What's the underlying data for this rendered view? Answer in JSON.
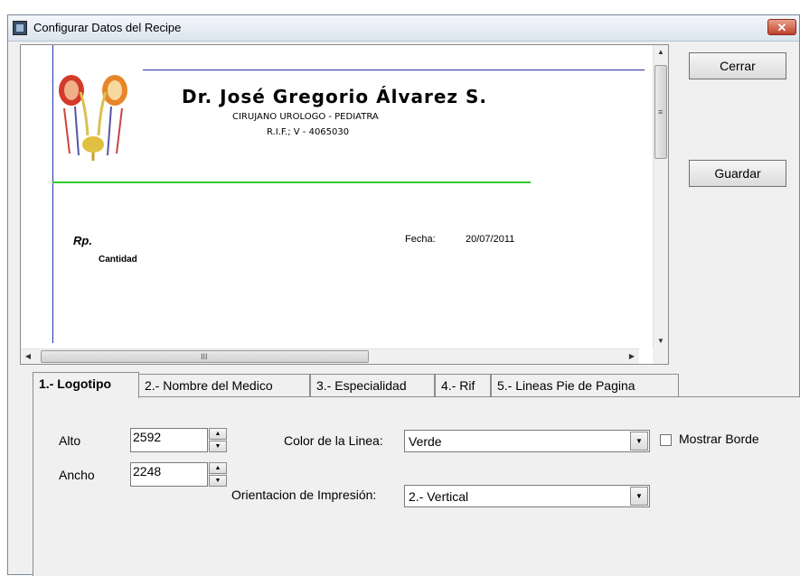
{
  "window": {
    "title": "Configurar Datos del Recipe",
    "close_glyph": "✕"
  },
  "preview": {
    "doctor_name": "Dr. José Gregorio Álvarez S.",
    "specialty": "CIRUJANO UROLOGO - PEDIATRA",
    "rif": "R.I.F.; V - 4065030",
    "rp_label": "Rp.",
    "cantidad_label": "Cantidad",
    "fecha_label": "Fecha:",
    "fecha_value": "20/07/2011",
    "vscroll_grip": "≡",
    "hscroll_grip": "III",
    "line_color": "#29cc2e",
    "frame_color": "#2034a8"
  },
  "buttons": {
    "cerrar": "Cerrar",
    "guardar": "Guardar"
  },
  "tabs": [
    {
      "label": "1.- Logotipo",
      "active": true
    },
    {
      "label": "2.- Nombre del Medico",
      "active": false
    },
    {
      "label": "3.- Especialidad",
      "active": false
    },
    {
      "label": "4.- Rif",
      "active": false
    },
    {
      "label": "5.- Lineas Pie de Pagina",
      "active": false
    }
  ],
  "form": {
    "alto_label": "Alto",
    "alto_value": "2592",
    "ancho_label": "Ancho",
    "ancho_value": "2248",
    "color_label": "Color de la Linea:",
    "color_value": "Verde",
    "orientacion_label": "Orientacion de Impresión:",
    "orientacion_value": "2.- Vertical",
    "mostrar_borde_label": "Mostrar Borde",
    "mostrar_borde_checked": false
  }
}
